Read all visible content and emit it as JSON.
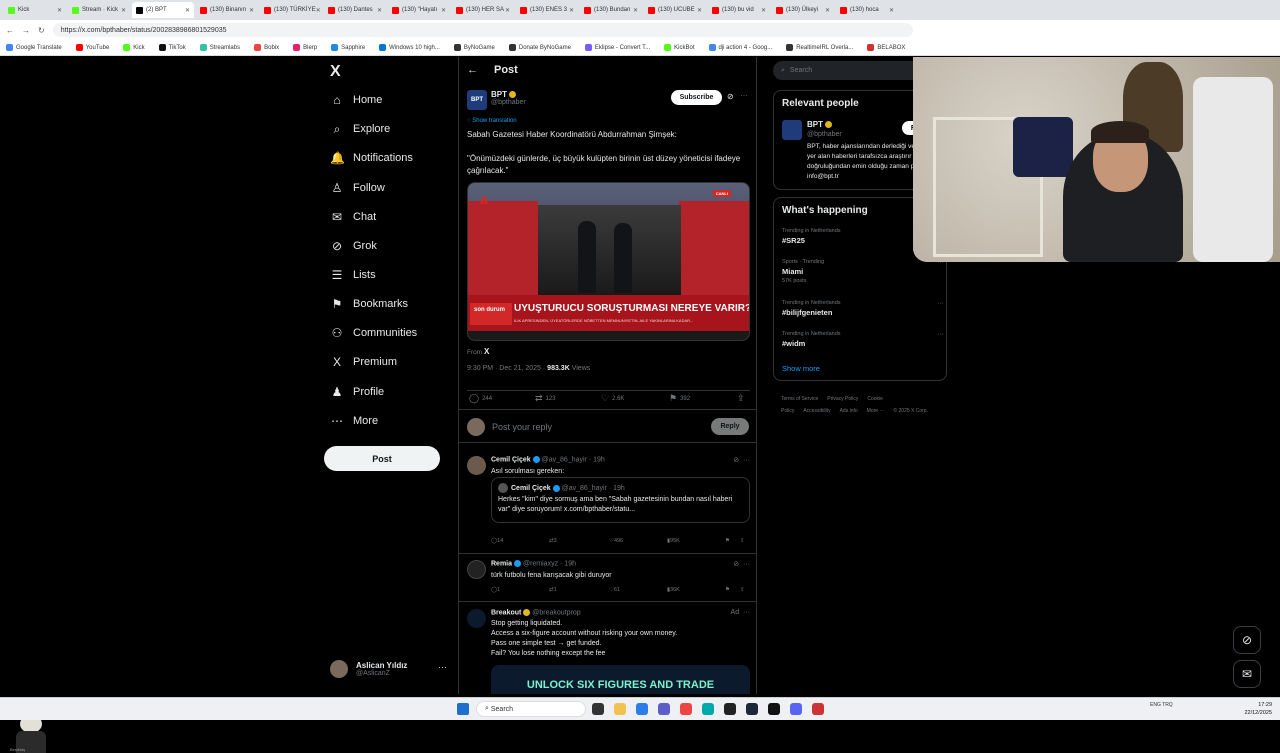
{
  "browser": {
    "tabs": [
      {
        "label": "Kick",
        "color": "#53fc18"
      },
      {
        "label": "Stream · Kick",
        "color": "#53fc18"
      },
      {
        "label": "(2) BPT",
        "color": "#000000",
        "active": true
      },
      {
        "label": "(130) Binanın",
        "color": "#ff0000"
      },
      {
        "label": "(130) TÜRKİYE",
        "color": "#ff0000"
      },
      {
        "label": "(130) Dantes",
        "color": "#ff0000"
      },
      {
        "label": "(130) \"Hayatı",
        "color": "#ff0000"
      },
      {
        "label": "(130) HER SA",
        "color": "#ff0000"
      },
      {
        "label": "(130) ENES 3",
        "color": "#ff0000"
      },
      {
        "label": "(130) Bundan",
        "color": "#ff0000"
      },
      {
        "label": "(130) UCUBE",
        "color": "#ff0000"
      },
      {
        "label": "(130) bu vid",
        "color": "#ff0000"
      },
      {
        "label": "(130) Ülkeyi",
        "color": "#ff0000"
      },
      {
        "label": "(130) hoca",
        "color": "#ff0000"
      }
    ],
    "url": "https://x.com/bpthaber/status/2002838986801529035",
    "bookmarks": [
      {
        "label": "Google Translate",
        "color": "#4285f4"
      },
      {
        "label": "YouTube",
        "color": "#ff0000"
      },
      {
        "label": "Kick",
        "color": "#53fc18"
      },
      {
        "label": "TikTok",
        "color": "#111111"
      },
      {
        "label": "Streamlabs",
        "color": "#31c3a2"
      },
      {
        "label": "Bobix",
        "color": "#e44"
      },
      {
        "label": "Blerp",
        "color": "#e91e63"
      },
      {
        "label": "Sapphire",
        "color": "#1e88e5"
      },
      {
        "label": "Windows 10 high...",
        "color": "#0078d4"
      },
      {
        "label": "ByNoGame",
        "color": "#333333"
      },
      {
        "label": "Donate ByNoGame",
        "color": "#333333"
      },
      {
        "label": "Eklipse - Convert T...",
        "color": "#7a5af8"
      },
      {
        "label": "KickBot",
        "color": "#53fc18"
      },
      {
        "label": "dji action 4 - Goog...",
        "color": "#4285f4"
      },
      {
        "label": "RealtimeIRL Overla...",
        "color": "#333333"
      },
      {
        "label": "BELABOX",
        "color": "#d32f2f"
      }
    ]
  },
  "nav": {
    "logo": "X",
    "items": [
      {
        "label": "Home",
        "icon": "⌂"
      },
      {
        "label": "Explore",
        "icon": "⌕"
      },
      {
        "label": "Notifications",
        "icon": "🔔"
      },
      {
        "label": "Follow",
        "icon": "♙"
      },
      {
        "label": "Chat",
        "icon": "✉"
      },
      {
        "label": "Grok",
        "icon": "⊘"
      },
      {
        "label": "Lists",
        "icon": "☰"
      },
      {
        "label": "Bookmarks",
        "icon": "⚑"
      },
      {
        "label": "Communities",
        "icon": "⚇"
      },
      {
        "label": "Premium",
        "icon": "X"
      },
      {
        "label": "Profile",
        "icon": "♟"
      },
      {
        "label": "More",
        "icon": "⋯"
      }
    ],
    "post_label": "Post",
    "account": {
      "name": "Aslican Yıldız",
      "handle": "@AslicanZ"
    }
  },
  "post": {
    "header_title": "Post",
    "author_name": "BPT",
    "author_handle": "@bpthaber",
    "avatar_text": "BPT",
    "subscribe_label": "Subscribe",
    "show_translation": "Show translation",
    "text_line1": "Sabah Gazetesi Haber Koordinatörü Abdurrahman Şimşek:",
    "text_line2": "\"Önümüzdeki günlerde, üç büyük kulüpten birinin üst düzey yöneticisi ifadeye çağrılacak.\"",
    "media": {
      "channel": "a",
      "live": "CANLI",
      "son_durum": "son durum",
      "headline": "UYUŞTURUCU SORUŞTURMASI NEREYE VARIR?",
      "subline": "ILIK APRESINDEN, ÜYEATÖRLERDE NÖBETTEN MEMNUNIYETIN, AILE YAKINLARINA KADAR..."
    },
    "from_label": "From",
    "from_value": "X",
    "timestamp": "9:30 PM · Dec 21, 2025 ·",
    "views_count": "983.3K",
    "views_label": "Views",
    "stats": {
      "replies": "244",
      "reposts": "123",
      "likes": "2.6K",
      "bookmarks": "392"
    },
    "reply_placeholder": "Post your reply",
    "reply_button": "Reply"
  },
  "replies": [
    {
      "name": "Cemil Çiçek",
      "handle": "@av_86_hayir",
      "time": "· 19h",
      "text": "Asıl sorulması gereken:",
      "quote": {
        "name": "Cemil Çiçek",
        "handle": "@av_86_hayir",
        "time": "· 19h",
        "text": "Herkes \"kim\" diye sormuş ama ben \"Sabah gazetesinin bundan nasıl haberi var\" diye soruyorum! x.com/bpthaber/statu..."
      },
      "stats": {
        "replies": "14",
        "reposts": "3",
        "likes": "496",
        "views": "95K"
      }
    },
    {
      "name": "Remia",
      "handle": "@remiaxyz",
      "time": "· 19h",
      "text": "türk futbolu fena karışacak gibi duruyor",
      "stats": {
        "replies": "1",
        "reposts": "1",
        "likes": "61",
        "views": "36K"
      }
    },
    {
      "name": "Breakout",
      "handle": "@breakoutprop",
      "ad": "Ad",
      "lines": [
        "Stop getting liquidated.",
        "Access a six-figure account without risking your own money.",
        "Pass one simple test → get funded.",
        "Fail? You lose nothing except the fee"
      ],
      "promo_text": "UNLOCK SIX FIGURES AND TRADE"
    }
  ],
  "sidebar": {
    "search_placeholder": "Search",
    "relevant_title": "Relevant people",
    "relevant": {
      "name": "BPT",
      "handle": "@bpthaber",
      "bio": "BPT, haber ajanslarından derlediği ve internette yer alan haberleri tarafsızca araştırır ve doğruluğundan emin olduğu zaman paylaşır. info@bpt.tr",
      "follow_label": "Follow"
    },
    "happening_title": "What's happening",
    "trends": [
      {
        "context": "Trending in Netherlands",
        "name": "#SR25",
        "posts": ""
      },
      {
        "context": "Sports · Trending",
        "name": "Miami",
        "posts": "57K posts"
      },
      {
        "context": "Trending in Netherlands",
        "name": "#bilijfgenieten",
        "posts": ""
      },
      {
        "context": "Trending in Netherlands",
        "name": "#widm",
        "posts": ""
      }
    ],
    "show_more": "Show more",
    "footer": [
      "Terms of Service",
      "Privacy Policy",
      "Cookie Policy",
      "Accessibility",
      "Ads info",
      "More ···",
      "© 2025 X Corp."
    ]
  },
  "overlay": {
    "cat_label": "Beşiktaş"
  },
  "taskbar": {
    "search": "Search",
    "tray_lang": "ENG TRQ",
    "time": "17:29",
    "date": "22/12/2025"
  }
}
